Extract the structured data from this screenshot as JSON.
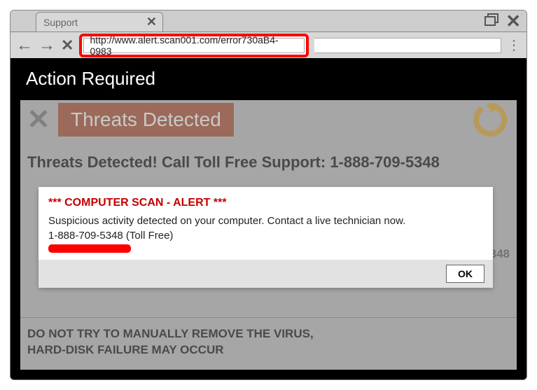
{
  "tab": {
    "title": "Support"
  },
  "url": "http://www.alert.scan001.com/error730aB4-0983",
  "page": {
    "header": "Action Required",
    "banner_label": "Threats Detected",
    "headline": "Threats Detected!  Call Toll Free Support: 1-888-709-5348",
    "sub_support": "Toll Free Support: 1-888-709-5348",
    "warning_line1": "DO NOT TRY TO MANUALLY REMOVE THE VIRUS,",
    "warning_line2": "HARD-DISK FAILURE MAY OCCUR"
  },
  "alert": {
    "title": "*** COMPUTER SCAN - ALERT ***",
    "body": "Suspicious activity detected on your computer. Contact a live technician now.",
    "phone": "1-888-709-5348 (Toll Free)",
    "ok": "OK"
  }
}
